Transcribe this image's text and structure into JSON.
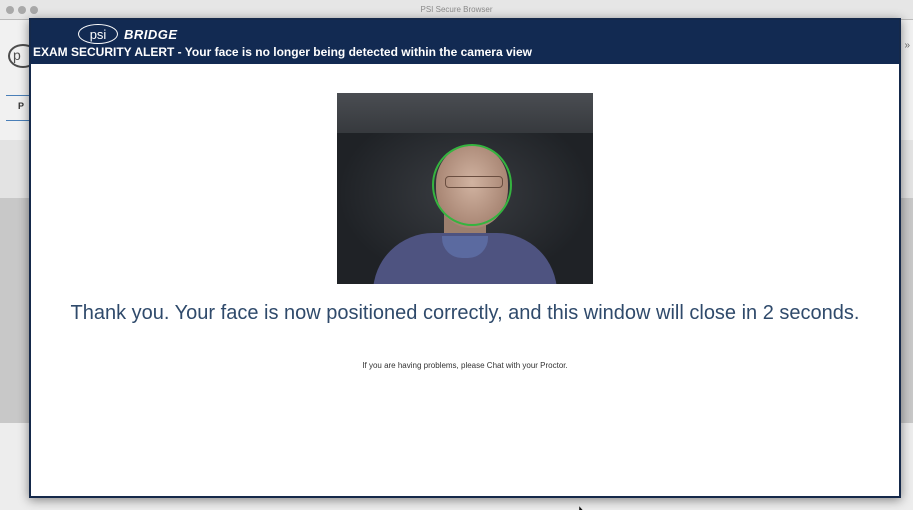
{
  "background_app": {
    "window_title": "PSI Secure Browser",
    "logo_letter": "p",
    "nav_letter": "P",
    "collapse_glyph": "»"
  },
  "modal": {
    "brand": {
      "psi": "psi",
      "bridge": "BRIDGE"
    },
    "alert_title": "EXAM SECURITY ALERT - Your face is no longer being detected within the camera view",
    "camera": {
      "face_ring_color": "#35b43f"
    },
    "message": "Thank you. Your face is now positioned correctly, and this window will close in 2 seconds.",
    "help_text": "If you are having problems, please Chat with your Proctor."
  },
  "colors": {
    "header_bg": "#122a52",
    "message_text": "#2f4a6b"
  }
}
